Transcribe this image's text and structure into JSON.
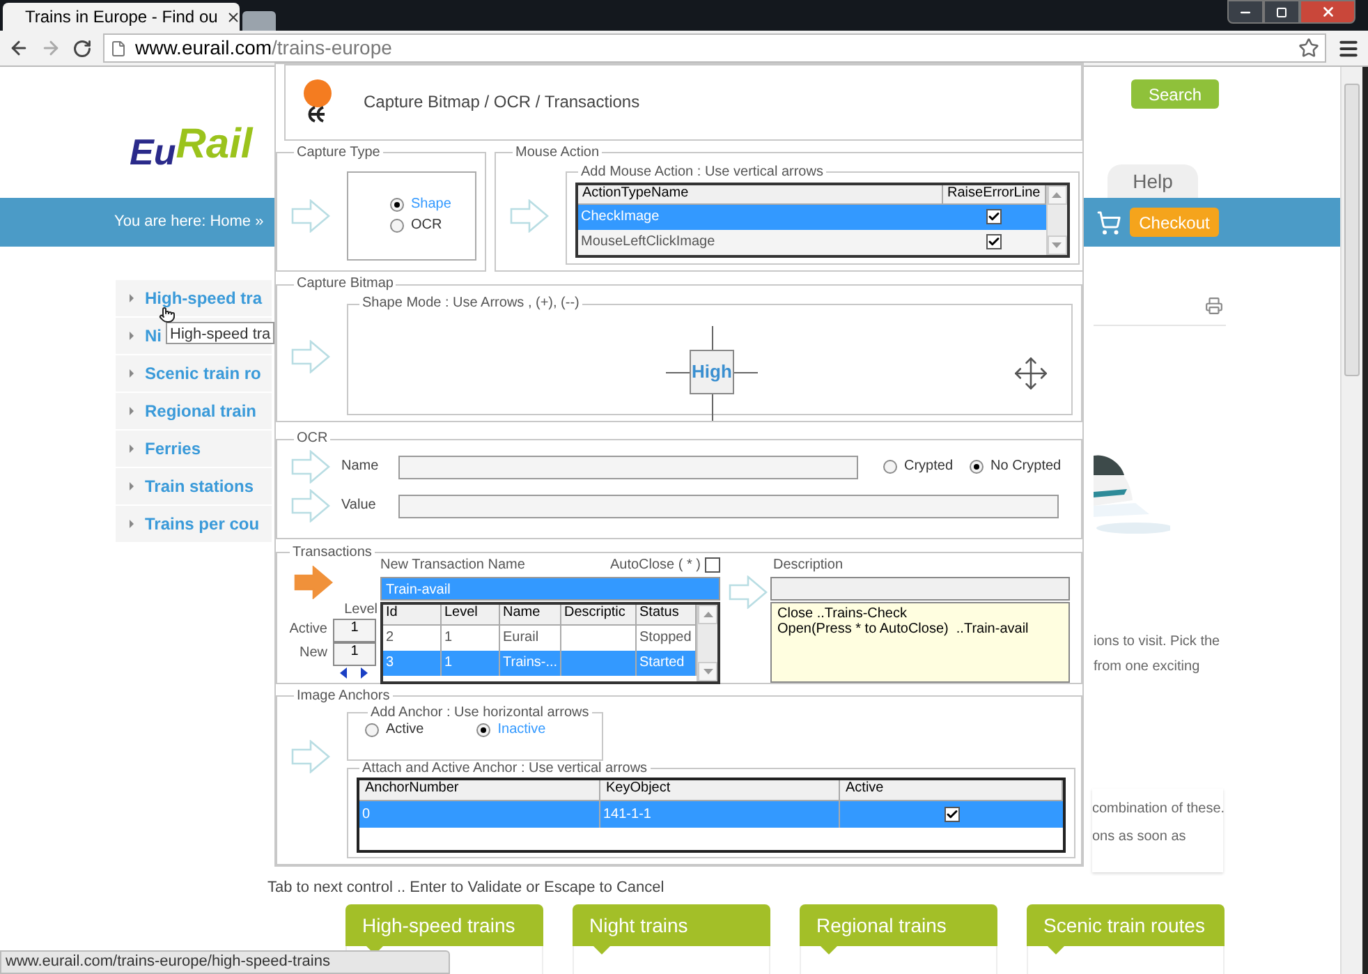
{
  "browser": {
    "tab_title": "Trains in Europe - Find ou",
    "url_host": "www.eurail.com",
    "url_path": "/trains-europe"
  },
  "page": {
    "logo": {
      "part_1": "Eu",
      "part_2": "Rail"
    },
    "search_button": "Search",
    "help_tab": "Help",
    "breadcrumb": "You are here: Home »",
    "checkout_button": "Checkout",
    "sidebar": [
      {
        "label": "High-speed tra"
      },
      {
        "label": "Ni"
      },
      {
        "label": "Scenic train ro"
      },
      {
        "label": "Regional train"
      },
      {
        "label": "Ferries"
      },
      {
        "label": "Train stations"
      },
      {
        "label": "Trains per cou"
      }
    ],
    "tooltip": "High-speed tra",
    "intro_lines": [
      "ions to visit. Pick the",
      "from one exciting"
    ],
    "card_lines": [
      "combination of these.",
      "ons as soon as"
    ],
    "category_tabs": [
      "High-speed trains",
      "Night trains",
      "Regional trains",
      "Scenic train routes"
    ],
    "status_url": "www.eurail.com/trains-europe/high-speed-trains"
  },
  "dialog": {
    "title": "Capture Bitmap / OCR / Transactions",
    "capture_type": {
      "legend": "Capture Type",
      "options": [
        {
          "label": "Shape",
          "selected": true
        },
        {
          "label": "OCR",
          "selected": false
        }
      ]
    },
    "mouse_action": {
      "legend": "Mouse Action",
      "sublegend": "Add Mouse Action : Use vertical arrows",
      "columns": [
        "ActionTypeName",
        "RaiseErrorLine"
      ],
      "rows": [
        {
          "name": "CheckImage",
          "raise_error": true,
          "selected": true
        },
        {
          "name": "MouseLeftClickImage",
          "raise_error": true,
          "selected": false
        }
      ]
    },
    "capture_bitmap": {
      "legend": "Capture Bitmap",
      "sublegend": "Shape Mode : Use Arrows , (+), (--)",
      "shape_text": "High"
    },
    "ocr": {
      "legend": "OCR",
      "name_label": "Name",
      "value_label": "Value",
      "crypt_options": [
        {
          "label": "Crypted",
          "selected": false
        },
        {
          "label": "No Crypted",
          "selected": true
        }
      ]
    },
    "transactions": {
      "legend": "Transactions",
      "name_label": "New Transaction Name",
      "name_value": "Train-avail",
      "autoclose_label": "AutoClose ( * )",
      "autoclose": false,
      "level_label": "Level",
      "active_label": "Active",
      "active_level": "1",
      "new_label": "New",
      "new_level": "1",
      "columns": [
        "Id",
        "Level",
        "Name",
        "Descriptic",
        "Status"
      ],
      "rows": [
        {
          "cells": [
            "2",
            "1",
            "Eurail",
            "",
            "Stopped"
          ],
          "selected": false
        },
        {
          "cells": [
            "3",
            "1",
            "Trains-...",
            "",
            "Started"
          ],
          "selected": true
        }
      ],
      "description_label": "Description",
      "description_lines": [
        "Close ..Trains-Check",
        "Open(Press * to AutoClose)  ..Train-avail"
      ]
    },
    "image_anchors": {
      "legend": "Image Anchors",
      "add_legend": "Add Anchor  : Use horizontal arrows",
      "options": [
        {
          "label": "Active",
          "selected": false
        },
        {
          "label": "Inactive",
          "selected": true
        }
      ],
      "attach_legend": "Attach and Active Anchor : Use vertical arrows",
      "columns": [
        "AnchorNumber",
        "KeyObject",
        "Active"
      ],
      "rows": [
        {
          "number": "0",
          "key": "141-1-1",
          "active": true,
          "selected": true
        }
      ]
    },
    "hint": "Tab to next control .. Enter to Validate or Escape to Cancel"
  }
}
